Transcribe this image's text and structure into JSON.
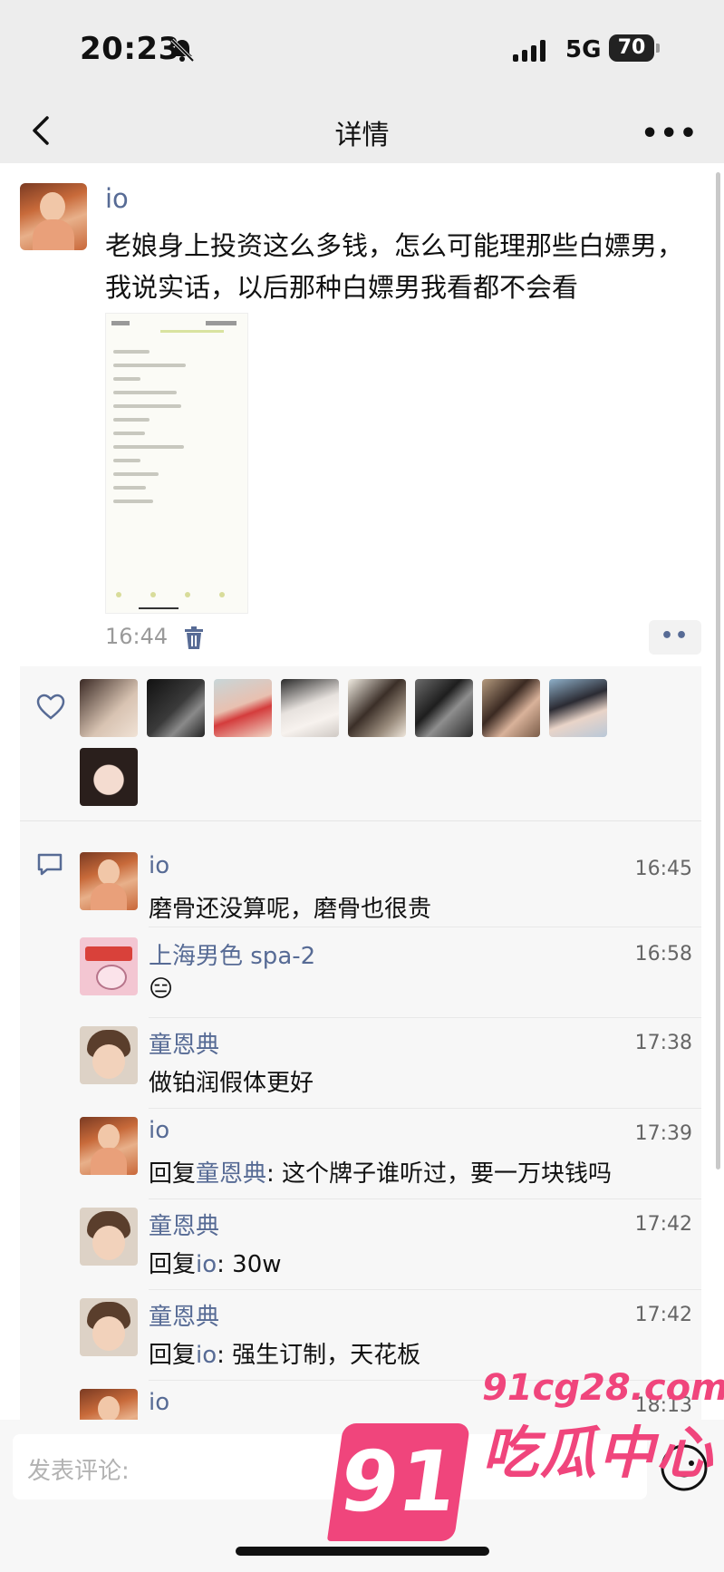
{
  "status_bar": {
    "time": "20:23",
    "network": "5G",
    "battery": "70"
  },
  "nav": {
    "title": "详情",
    "back_icon": "chevron-left-icon",
    "more_icon": "ellipsis-icon"
  },
  "post": {
    "author": "io",
    "text": "老娘身上投资这么多钱，怎么可能理那些白嫖男，我说实话，以后那种白嫖男我看都不会看",
    "time": "16:44",
    "delete_icon": "trash-icon",
    "action_icon": "two-dots-icon"
  },
  "likes": {
    "icon": "heart-outline-icon",
    "count": 9
  },
  "comments": {
    "icon": "comment-bubble-icon",
    "items": [
      {
        "name": "io",
        "time": "16:45",
        "text": "磨骨还没算呢，磨骨也很贵"
      },
      {
        "name": "上海男色 spa-2",
        "time": "16:58",
        "text": "😑"
      },
      {
        "name": "童恩典",
        "time": "17:38",
        "text": "做铂润假体更好"
      },
      {
        "name": "io",
        "time": "17:39",
        "reply_prefix": "回复",
        "reply_to": "童恩典",
        "text": ": 这个牌子谁听过，要一万块钱吗"
      },
      {
        "name": "童恩典",
        "time": "17:42",
        "reply_prefix": "回复",
        "reply_to": "io",
        "text": ": 30w"
      },
      {
        "name": "童恩典",
        "time": "17:42",
        "reply_prefix": "回复",
        "reply_to": "io",
        "text": ": 强生订制，天花板"
      },
      {
        "name": "io",
        "time": "18:13",
        "text": ""
      }
    ]
  },
  "input": {
    "placeholder": "发表评论:",
    "emoji_icon": "smiley-icon"
  },
  "watermark": {
    "logo": "91",
    "url": "91cg28.com",
    "brand": "吃瓜中心"
  },
  "colors": {
    "link": "#576b95",
    "background": "#ededed",
    "panel": "#f7f7f7",
    "watermark": "#f0457c"
  }
}
